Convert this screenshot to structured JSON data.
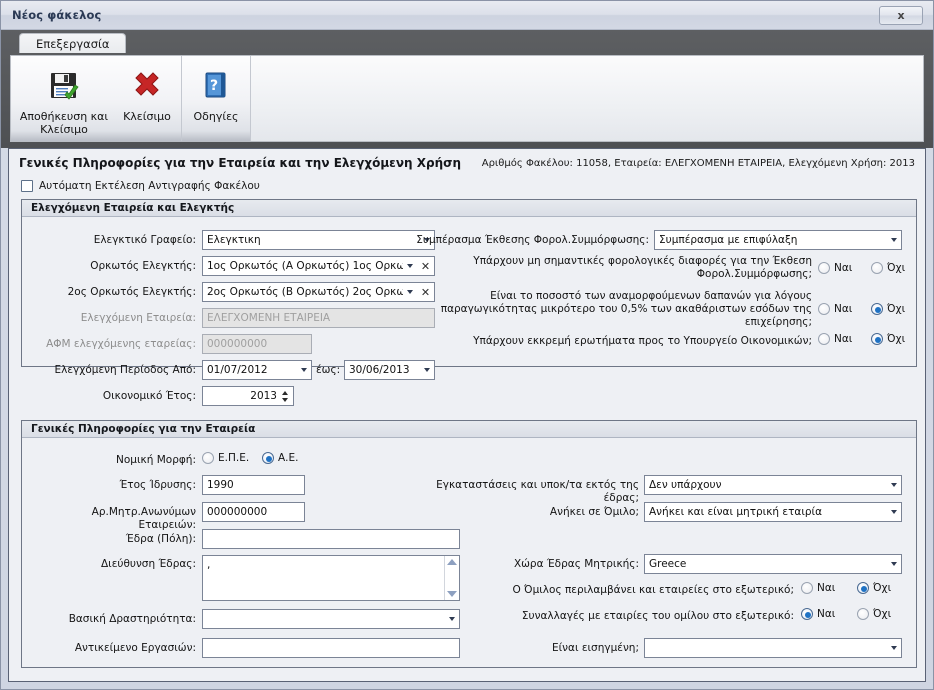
{
  "window": {
    "title": "Νέος φάκελος",
    "close_label": "x"
  },
  "ribbon": {
    "tab_label": "Επεξεργασία",
    "buttons": [
      {
        "label": "Αποθήκευση και Κλείσιμο",
        "icon": "save-disk-icon"
      },
      {
        "label": "Κλείσιμο",
        "icon": "red-x-icon"
      },
      {
        "label": "Οδηγίες",
        "icon": "help-book-icon"
      }
    ]
  },
  "page": {
    "title": "Γενικές Πληροφορίες για την Εταιρεία και την Ελεγχόμενη Χρήση",
    "info": "Αριθμός Φακέλου: 11058, Εταιρεία: ΕΛΕΓΧΟΜΕΝΗ ΕΤΑΙΡΕΙΑ, Ελεγχόμενη Χρήση: 2013",
    "auto_copy_label": "Αυτόματη Εκτέλεση Αντιγραφής Φακέλου",
    "auto_copy_checked": false
  },
  "group1": {
    "title": "Ελεγχόμενη Εταιρεία και Ελεγκτής",
    "left": {
      "audit_firm_label": "Ελεγκτικό Γραφείο:",
      "audit_firm_value": "Ελεγκτικη",
      "auditor1_label": "Ορκωτός Ελεγκτής:",
      "auditor1_value": "1ος Ορκωτός (Α Ορκωτός) 1ος Ορκω…",
      "auditor2_label": "2ος Ορκωτός Ελεγκτής:",
      "auditor2_value": "2ος Ορκωτός (Β Ορκωτός) 2ος Ορκω…",
      "company_label": "Ελεγχόμενη Εταιρεία:",
      "company_value": "ΕΛΕΓΧΟΜΕΝΗ ΕΤΑΙΡΕΙΑ",
      "vat_label": "ΑΦΜ ελεγχόμενης εταρείας:",
      "vat_value": "000000000",
      "period_from_label": "Ελεγχόμενη Περίοδος Από:",
      "period_from_value": "01/07/2012",
      "period_to_label": "έως:",
      "period_to_value": "30/06/2013",
      "fiscal_year_label": "Οικονομικό Έτος:",
      "fiscal_year_value": "2013"
    },
    "right": {
      "conclusion_label": "Συμπέρασμα Έκθεσης Φορολ.Συμμόρφωσης:",
      "conclusion_value": "Συμπέρασμα με επιφύλαξη",
      "q1_label": "Υπάρχουν μη σημαντικές φορολογικές διαφορές για την Έκθεση Φορολ.Συμμόρφωσης;",
      "q1_yes": "Ναι",
      "q1_no": "Όχι",
      "q1_selected": "none",
      "q2_label": "Είναι το ποσοστό των αναμορφούμενων δαπανών για λόγους παραγωγικότητας μικρότερο του 0,5% των ακαθάριστων εσόδων της επιχείρησης;",
      "q2_yes": "Ναι",
      "q2_no": "Όχι",
      "q2_selected": "no",
      "q3_label": "Υπάρχουν εκκρεμή ερωτήματα προς το Υπουργείο Οικονομικών;",
      "q3_yes": "Ναι",
      "q3_no": "Όχι",
      "q3_selected": "no"
    }
  },
  "group2": {
    "title": "Γενικές Πληροφορίες για την Εταιρεία",
    "left": {
      "legal_form_label": "Νομική Μορφή:",
      "legal_form_opt1": "Ε.Π.Ε.",
      "legal_form_opt2": "Α.Ε.",
      "legal_form_selected": "ae",
      "founded_label": "Έτος Ίδρυσης:",
      "founded_value": "1990",
      "registry_label": "Αρ.Μητρ.Ανωνύμων Εταιρειών:",
      "registry_value": "000000000",
      "city_label": "Έδρα (Πόλη):",
      "city_value": "",
      "address_label": "Διεύθυνση Έδρας:",
      "address_value": ",",
      "activity_label": "Βασική Δραστηριότητα:",
      "activity_value": "",
      "business_label": "Αντικείμενο Εργασιών:",
      "business_value": ""
    },
    "right": {
      "branches_label": "Εγκαταστάσεις και υποκ/τα εκτός της έδρας;",
      "branches_value": "Δεν υπάρχουν",
      "group_label": "Ανήκει σε Όμιλο;",
      "group_value": "Ανήκει και είναι μητρική εταιρία",
      "parent_country_label": "Χώρα Έδρας Μητρικής:",
      "parent_country_value": "Greece",
      "foreign_label": "Ο Όμιλος περιλαμβάνει και εταιρείες στο εξωτερικό;",
      "foreign_yes": "Ναι",
      "foreign_no": "Όχι",
      "foreign_selected": "no",
      "transactions_label": "Συναλλαγές με εταιρίες του ομίλου στο εξωτερικό:",
      "transactions_yes": "Ναι",
      "transactions_no": "Όχι",
      "transactions_selected": "yes",
      "listed_label": "Είναι εισηγμένη;",
      "listed_value": ""
    }
  }
}
